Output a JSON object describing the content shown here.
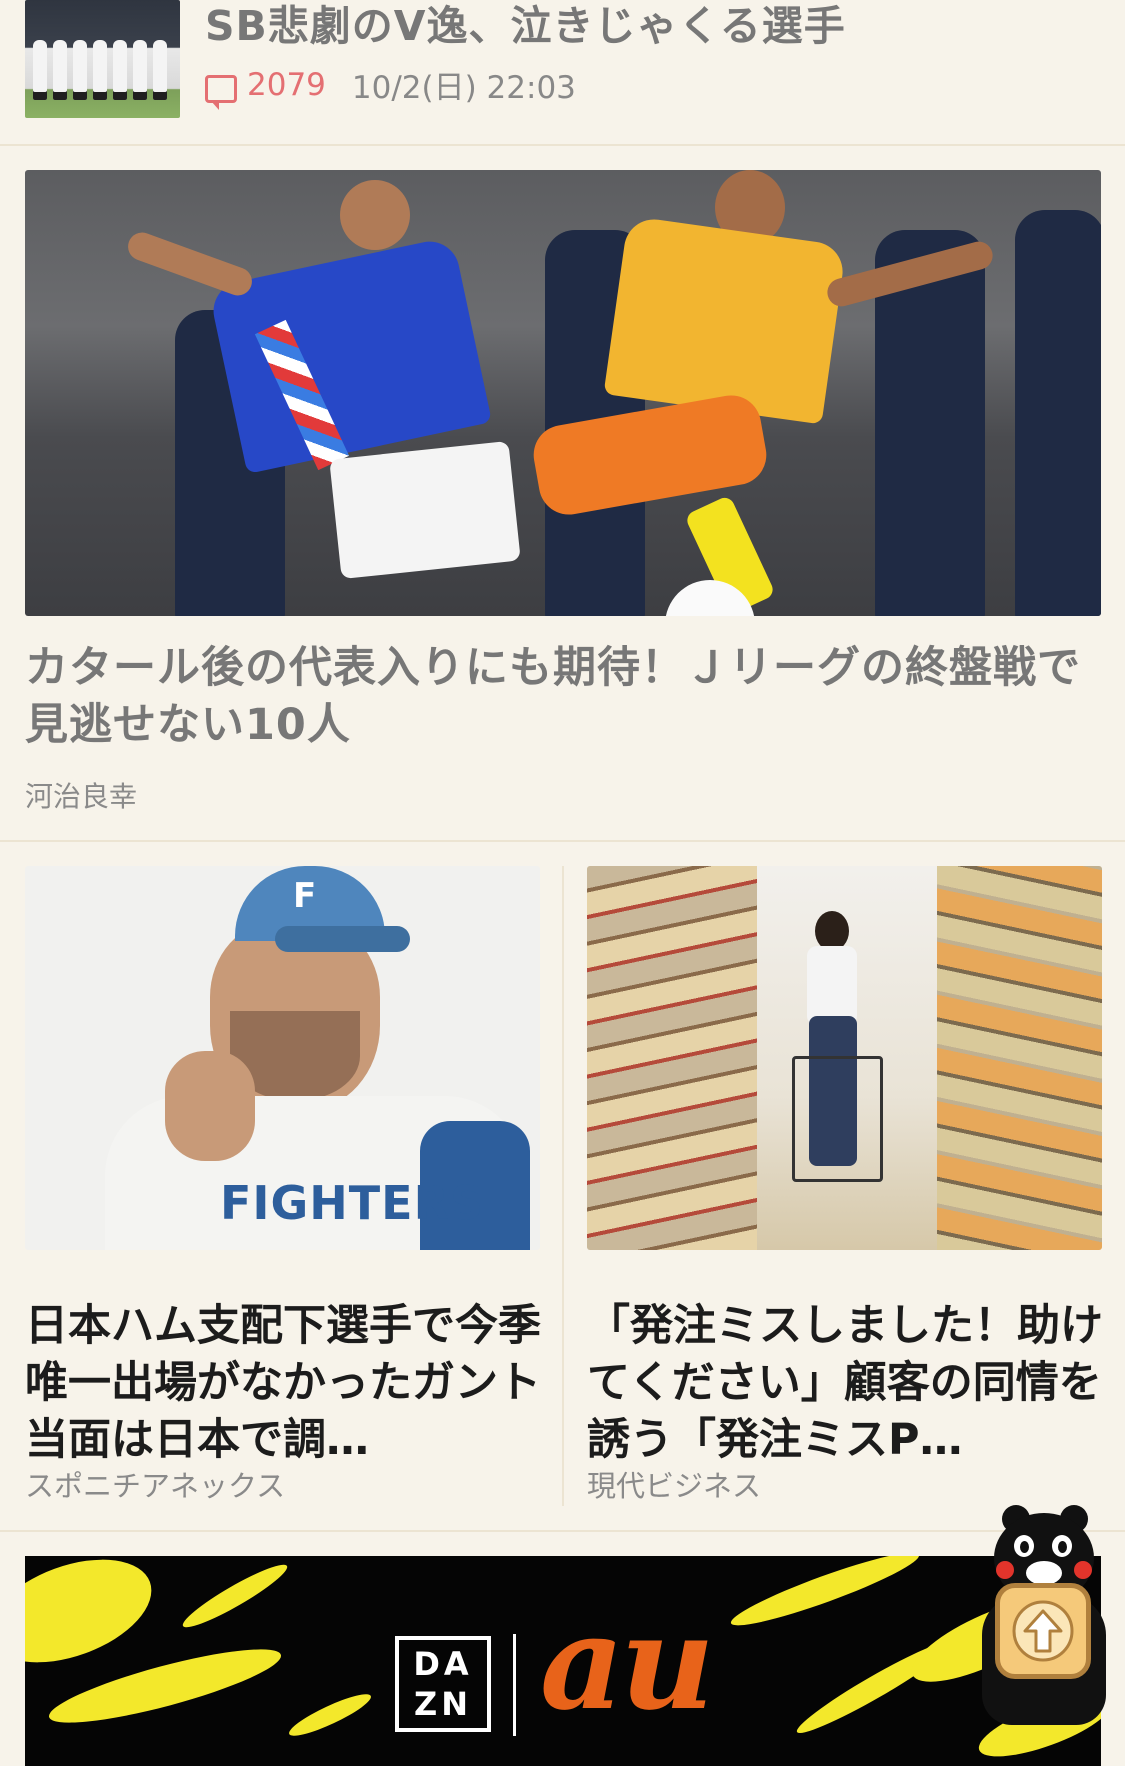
{
  "top_item": {
    "title": "SB悲劇のV逸、泣きじゃくる選手",
    "comment_count": "2079",
    "datetime": "10/2(日) 22:03"
  },
  "hero": {
    "title": "カタール後の代表入りにも期待！Ｊリーグの終盤戦で見逃せない10人",
    "source": "河治良幸",
    "image_icon": "soccer-photo"
  },
  "cards": [
    {
      "title": "日本ハム支配下選手で今季唯一出場がなかったガント　当面は日本で調…",
      "source": "スポニチアネックス",
      "image_icon": "baseball-player-photo"
    },
    {
      "title": "「発注ミスしました！助けてください」顧客の同情を誘う「発注ミスP…",
      "source": "現代ビジネス",
      "image_icon": "supermarket-photo"
    }
  ],
  "ad": {
    "brand1_line1": "DA",
    "brand1_line2": "ZN",
    "brand2": "au"
  },
  "floating": {
    "back_to_top_icon": "up-arrow-icon",
    "mascot_icon": "bear-mascot-icon"
  },
  "colors": {
    "background": "#f7f3ea",
    "comment_accent": "#e46f72",
    "ad_yellow": "#f3e82b",
    "au_orange": "#e8631a"
  }
}
